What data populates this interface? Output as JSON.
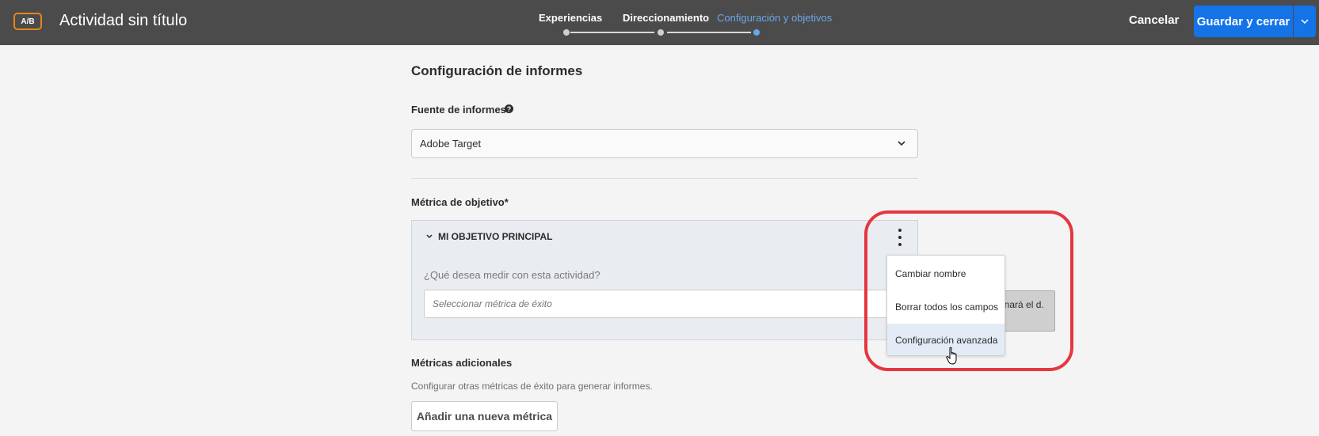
{
  "header": {
    "badge": "A/B",
    "title": "Actividad sin título",
    "steps": [
      {
        "label": "Experiencias",
        "active": false
      },
      {
        "label": "Direccionamiento",
        "active": false
      },
      {
        "label": "Configuración y objetivos",
        "active": true
      }
    ],
    "cancel_label": "Cancelar",
    "save_label": "Guardar y cerrar"
  },
  "reporting": {
    "heading": "Configuración de informes",
    "source_label": "Fuente de informes",
    "source_value": "Adobe Target"
  },
  "goal": {
    "label": "Métrica de objetivo*",
    "card_title": "MI OBJETIVO PRINCIPAL",
    "question": "¿Qué desea medir con esta actividad?",
    "metric_placeholder": "Seleccionar métrica de éxito",
    "tooltip_text": "minará el d."
  },
  "menu": {
    "items": [
      "Cambiar nombre",
      "Borrar todos los campos",
      "Configuración avanzada"
    ],
    "hovered_index": 2
  },
  "additional": {
    "label": "Métricas adicionales",
    "description": "Configurar otras métricas de éxito para generar informes.",
    "add_button": "Añadir una nueva métrica"
  },
  "colors": {
    "topbar": "#4b4b4b",
    "accent_blue": "#1473e6",
    "active_step": "#6aa7e8",
    "badge_orange": "#e68619",
    "highlight_red": "#e6363f"
  }
}
